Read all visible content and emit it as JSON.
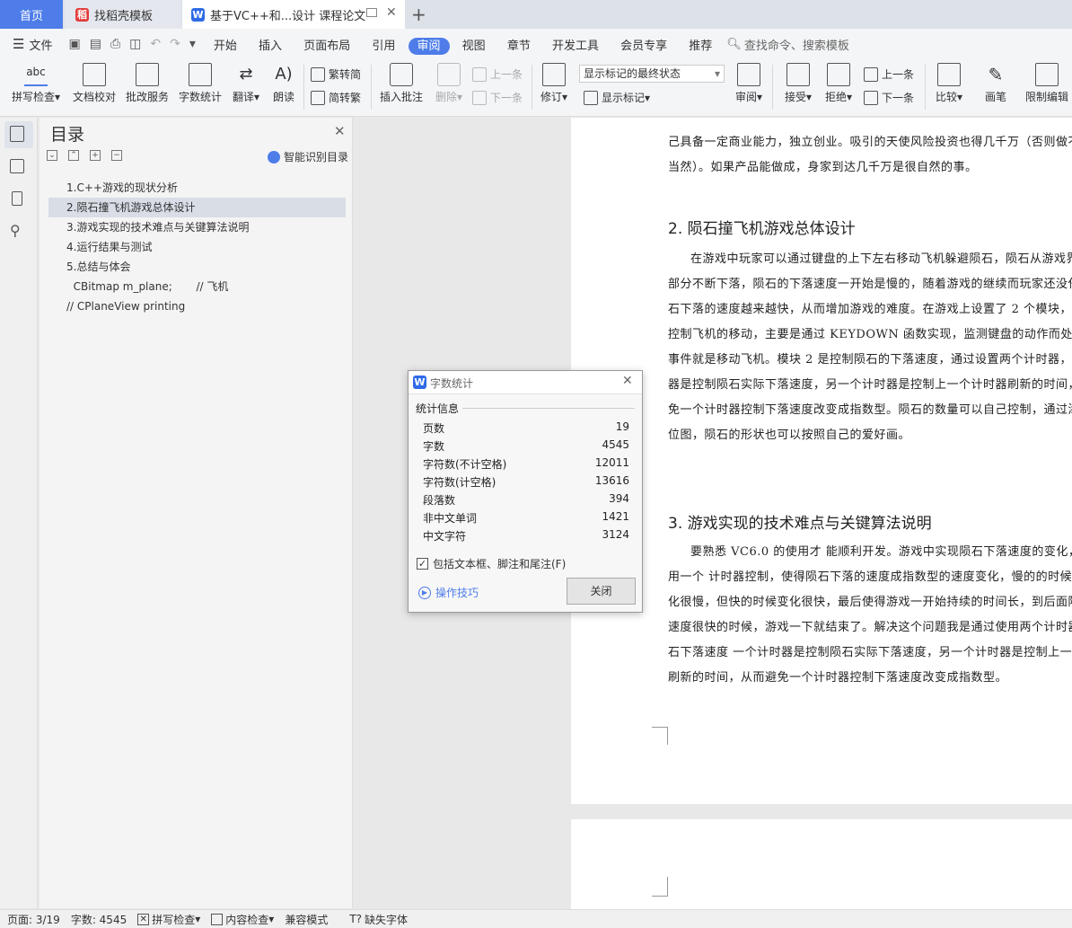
{
  "tabs": {
    "home": "首页",
    "template": "找稻壳模板",
    "doc": "基于VC++和...设计 课程论文"
  },
  "menu": {
    "file": "文件",
    "items": [
      "开始",
      "插入",
      "页面布局",
      "引用",
      "审阅",
      "视图",
      "章节",
      "开发工具",
      "会员专享",
      "推荐"
    ],
    "active": "审阅",
    "search": "查找命令、搜索模板"
  },
  "ribbon": {
    "spell": "拼写检查",
    "proofread": "文档校对",
    "review_service": "批改服务",
    "word_count": "字数统计",
    "translate": "翻译",
    "read_aloud": "朗读",
    "trad_to_simp": "繁转简",
    "simp_to_trad": "简转繁",
    "insert_comment": "插入批注",
    "delete": "删除",
    "prev_comment": "上一条",
    "next_comment": "下一条",
    "track_changes": "修订",
    "markup_state": "显示标记的最终状态",
    "show_markup": "显示标记",
    "review": "审阅",
    "accept": "接受",
    "reject": "拒绝",
    "prev": "上一条",
    "next": "下一条",
    "compare": "比较",
    "pen": "画笔",
    "restrict": "限制编辑",
    "abc": "abc"
  },
  "outline": {
    "title": "目录",
    "smart": "智能识别目录",
    "items": [
      "1.C++游戏的现状分析",
      "2.陨石撞飞机游戏总体设计",
      "3.游戏实现的技术难点与关键算法说明",
      "4.运行结果与测试",
      "5.总结与体会",
      "  CBitmap m_plane;       // 飞机",
      "// CPlaneView printing"
    ]
  },
  "document": {
    "p0": [
      "己具备一定商业能力，独立创业。吸引的天使风险投资也得几千万（否则做不",
      "当然）。如果产品能做成，身家到达几千万是很自然的事。"
    ],
    "h2": "2. 陨石撞飞机游戏总体设计",
    "p1": [
      "在游戏中玩家可以通过键盘的上下左右移动飞机躲避陨石，陨石从游戏界",
      "部分不断下落，陨石的下落速度一开始是慢的，随着游戏的继续而玩家还没任",
      "石下落的速度越来越快，从而增加游戏的难度。在游戏上设置了 2 个模块，模",
      "控制飞机的移动，主要是通过 KEYDOWN 函数实现，监测键盘的动作而处理相",
      "事件就是移动飞机。模块 2 是控制陨石的下落速度，通过设置两个计时器，一",
      "器是控制陨石实际下落速度，另一个计时器是控制上一个计时器刷新的时间，",
      "免一个计时器控制下落速度改变成指数型。陨石的数量可以自己控制，通过添",
      "位图，陨石的形状也可以按照自己的爱好画。"
    ],
    "h3": "3. 游戏实现的技术难点与关键算法说明",
    "p2": [
      "要熟悉 VC6.0 的使用才 能顺利开发。游戏中实现陨石下落速度的变化，一",
      "用一个 计时器控制，使得陨石下落的速度成指数型的速度变化，慢的的时候，",
      "化很慢，但快的时候变化很快，最后使得游戏一开始持续的时间长，到后面陨",
      "速度很快的时候，游戏一下就结束了。解决这个问题我是通过使用两个计时器",
      "石下落速度 一个计时器是控制陨石实际下落速度，另一个计时器是控制上一个",
      "刷新的时间，从而避免一个计时器控制下落速度改变成指数型。"
    ]
  },
  "dialog": {
    "title": "字数统计",
    "section": "统计信息",
    "rows": [
      {
        "label": "页数",
        "value": "19"
      },
      {
        "label": "字数",
        "value": "4545"
      },
      {
        "label": "字符数(不计空格)",
        "value": "12011"
      },
      {
        "label": "字符数(计空格)",
        "value": "13616"
      },
      {
        "label": "段落数",
        "value": "394"
      },
      {
        "label": "非中文单词",
        "value": "1421"
      },
      {
        "label": "中文字符",
        "value": "3124"
      }
    ],
    "include": "包括文本框、脚注和尾注(F)",
    "tips": "操作技巧",
    "close": "关闭"
  },
  "status": {
    "page": "页面: 3/19",
    "words": "字数: 4545",
    "spell": "拼写检查",
    "content": "内容检查",
    "compat": "兼容模式",
    "missing_font": "缺失字体"
  }
}
